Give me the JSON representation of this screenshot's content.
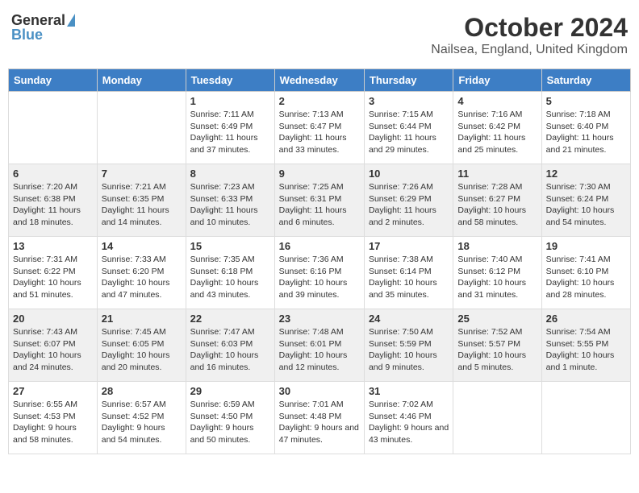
{
  "header": {
    "logo_general": "General",
    "logo_blue": "Blue",
    "title": "October 2024",
    "subtitle": "Nailsea, England, United Kingdom"
  },
  "days_of_week": [
    "Sunday",
    "Monday",
    "Tuesday",
    "Wednesday",
    "Thursday",
    "Friday",
    "Saturday"
  ],
  "weeks": [
    [
      {
        "day": "",
        "info": ""
      },
      {
        "day": "",
        "info": ""
      },
      {
        "day": "1",
        "info": "Sunrise: 7:11 AM\nSunset: 6:49 PM\nDaylight: 11 hours and 37 minutes."
      },
      {
        "day": "2",
        "info": "Sunrise: 7:13 AM\nSunset: 6:47 PM\nDaylight: 11 hours and 33 minutes."
      },
      {
        "day": "3",
        "info": "Sunrise: 7:15 AM\nSunset: 6:44 PM\nDaylight: 11 hours and 29 minutes."
      },
      {
        "day": "4",
        "info": "Sunrise: 7:16 AM\nSunset: 6:42 PM\nDaylight: 11 hours and 25 minutes."
      },
      {
        "day": "5",
        "info": "Sunrise: 7:18 AM\nSunset: 6:40 PM\nDaylight: 11 hours and 21 minutes."
      }
    ],
    [
      {
        "day": "6",
        "info": "Sunrise: 7:20 AM\nSunset: 6:38 PM\nDaylight: 11 hours and 18 minutes."
      },
      {
        "day": "7",
        "info": "Sunrise: 7:21 AM\nSunset: 6:35 PM\nDaylight: 11 hours and 14 minutes."
      },
      {
        "day": "8",
        "info": "Sunrise: 7:23 AM\nSunset: 6:33 PM\nDaylight: 11 hours and 10 minutes."
      },
      {
        "day": "9",
        "info": "Sunrise: 7:25 AM\nSunset: 6:31 PM\nDaylight: 11 hours and 6 minutes."
      },
      {
        "day": "10",
        "info": "Sunrise: 7:26 AM\nSunset: 6:29 PM\nDaylight: 11 hours and 2 minutes."
      },
      {
        "day": "11",
        "info": "Sunrise: 7:28 AM\nSunset: 6:27 PM\nDaylight: 10 hours and 58 minutes."
      },
      {
        "day": "12",
        "info": "Sunrise: 7:30 AM\nSunset: 6:24 PM\nDaylight: 10 hours and 54 minutes."
      }
    ],
    [
      {
        "day": "13",
        "info": "Sunrise: 7:31 AM\nSunset: 6:22 PM\nDaylight: 10 hours and 51 minutes."
      },
      {
        "day": "14",
        "info": "Sunrise: 7:33 AM\nSunset: 6:20 PM\nDaylight: 10 hours and 47 minutes."
      },
      {
        "day": "15",
        "info": "Sunrise: 7:35 AM\nSunset: 6:18 PM\nDaylight: 10 hours and 43 minutes."
      },
      {
        "day": "16",
        "info": "Sunrise: 7:36 AM\nSunset: 6:16 PM\nDaylight: 10 hours and 39 minutes."
      },
      {
        "day": "17",
        "info": "Sunrise: 7:38 AM\nSunset: 6:14 PM\nDaylight: 10 hours and 35 minutes."
      },
      {
        "day": "18",
        "info": "Sunrise: 7:40 AM\nSunset: 6:12 PM\nDaylight: 10 hours and 31 minutes."
      },
      {
        "day": "19",
        "info": "Sunrise: 7:41 AM\nSunset: 6:10 PM\nDaylight: 10 hours and 28 minutes."
      }
    ],
    [
      {
        "day": "20",
        "info": "Sunrise: 7:43 AM\nSunset: 6:07 PM\nDaylight: 10 hours and 24 minutes."
      },
      {
        "day": "21",
        "info": "Sunrise: 7:45 AM\nSunset: 6:05 PM\nDaylight: 10 hours and 20 minutes."
      },
      {
        "day": "22",
        "info": "Sunrise: 7:47 AM\nSunset: 6:03 PM\nDaylight: 10 hours and 16 minutes."
      },
      {
        "day": "23",
        "info": "Sunrise: 7:48 AM\nSunset: 6:01 PM\nDaylight: 10 hours and 12 minutes."
      },
      {
        "day": "24",
        "info": "Sunrise: 7:50 AM\nSunset: 5:59 PM\nDaylight: 10 hours and 9 minutes."
      },
      {
        "day": "25",
        "info": "Sunrise: 7:52 AM\nSunset: 5:57 PM\nDaylight: 10 hours and 5 minutes."
      },
      {
        "day": "26",
        "info": "Sunrise: 7:54 AM\nSunset: 5:55 PM\nDaylight: 10 hours and 1 minute."
      }
    ],
    [
      {
        "day": "27",
        "info": "Sunrise: 6:55 AM\nSunset: 4:53 PM\nDaylight: 9 hours and 58 minutes."
      },
      {
        "day": "28",
        "info": "Sunrise: 6:57 AM\nSunset: 4:52 PM\nDaylight: 9 hours and 54 minutes."
      },
      {
        "day": "29",
        "info": "Sunrise: 6:59 AM\nSunset: 4:50 PM\nDaylight: 9 hours and 50 minutes."
      },
      {
        "day": "30",
        "info": "Sunrise: 7:01 AM\nSunset: 4:48 PM\nDaylight: 9 hours and 47 minutes."
      },
      {
        "day": "31",
        "info": "Sunrise: 7:02 AM\nSunset: 4:46 PM\nDaylight: 9 hours and 43 minutes."
      },
      {
        "day": "",
        "info": ""
      },
      {
        "day": "",
        "info": ""
      }
    ]
  ],
  "row_shading": [
    "white",
    "shaded",
    "white",
    "shaded",
    "white"
  ]
}
